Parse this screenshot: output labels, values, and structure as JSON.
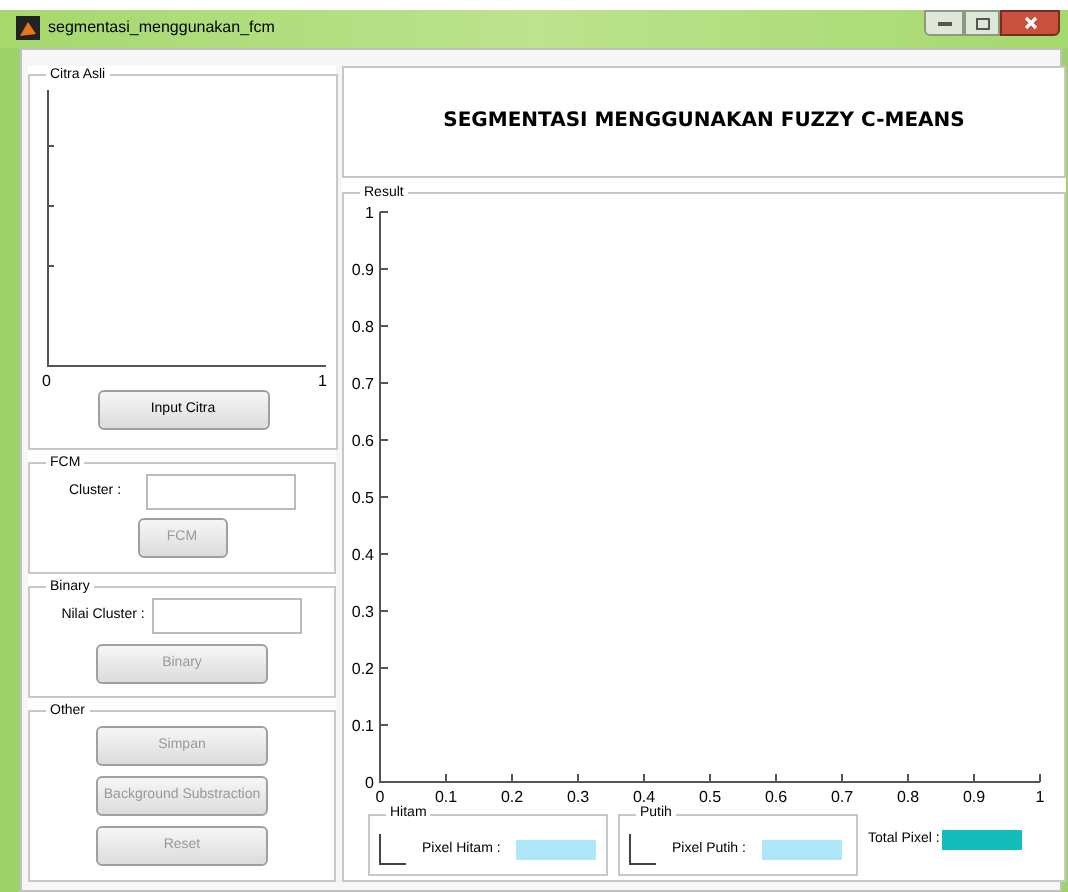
{
  "window": {
    "title": "segmentasi_menggunakan_fcm"
  },
  "heading": "SEGMENTASI MENGGUNAKAN FUZZY C-MEANS",
  "citra_asli": {
    "title": "Citra Asli",
    "xticks": [
      "0",
      "1"
    ],
    "button": {
      "label": "Input Citra",
      "disabled": false
    }
  },
  "fcm": {
    "title": "FCM",
    "label": "Cluster :",
    "button": {
      "label": "FCM",
      "disabled": true
    }
  },
  "binary": {
    "title": "Binary",
    "label": "Nilai Cluster :",
    "button": {
      "label": "Binary",
      "disabled": true
    }
  },
  "other": {
    "title": "Other",
    "buttons": [
      {
        "label": "Simpan",
        "disabled": true
      },
      {
        "label": "Background Substraction",
        "disabled": true
      },
      {
        "label": "Reset",
        "disabled": true
      }
    ]
  },
  "result": {
    "title": "Result",
    "yticks": [
      "1",
      "0.9",
      "0.8",
      "0.7",
      "0.6",
      "0.5",
      "0.4",
      "0.3",
      "0.2",
      "0.1",
      "0"
    ],
    "xticks": [
      "0",
      "0.1",
      "0.2",
      "0.3",
      "0.4",
      "0.5",
      "0.6",
      "0.7",
      "0.8",
      "0.9",
      "1"
    ],
    "panels": [
      {
        "title": "Hitam",
        "label": "Pixel Hitam :"
      },
      {
        "title": "Putih",
        "label": "Pixel Putih :"
      }
    ],
    "total": {
      "label": "Total Pixel :"
    }
  }
}
